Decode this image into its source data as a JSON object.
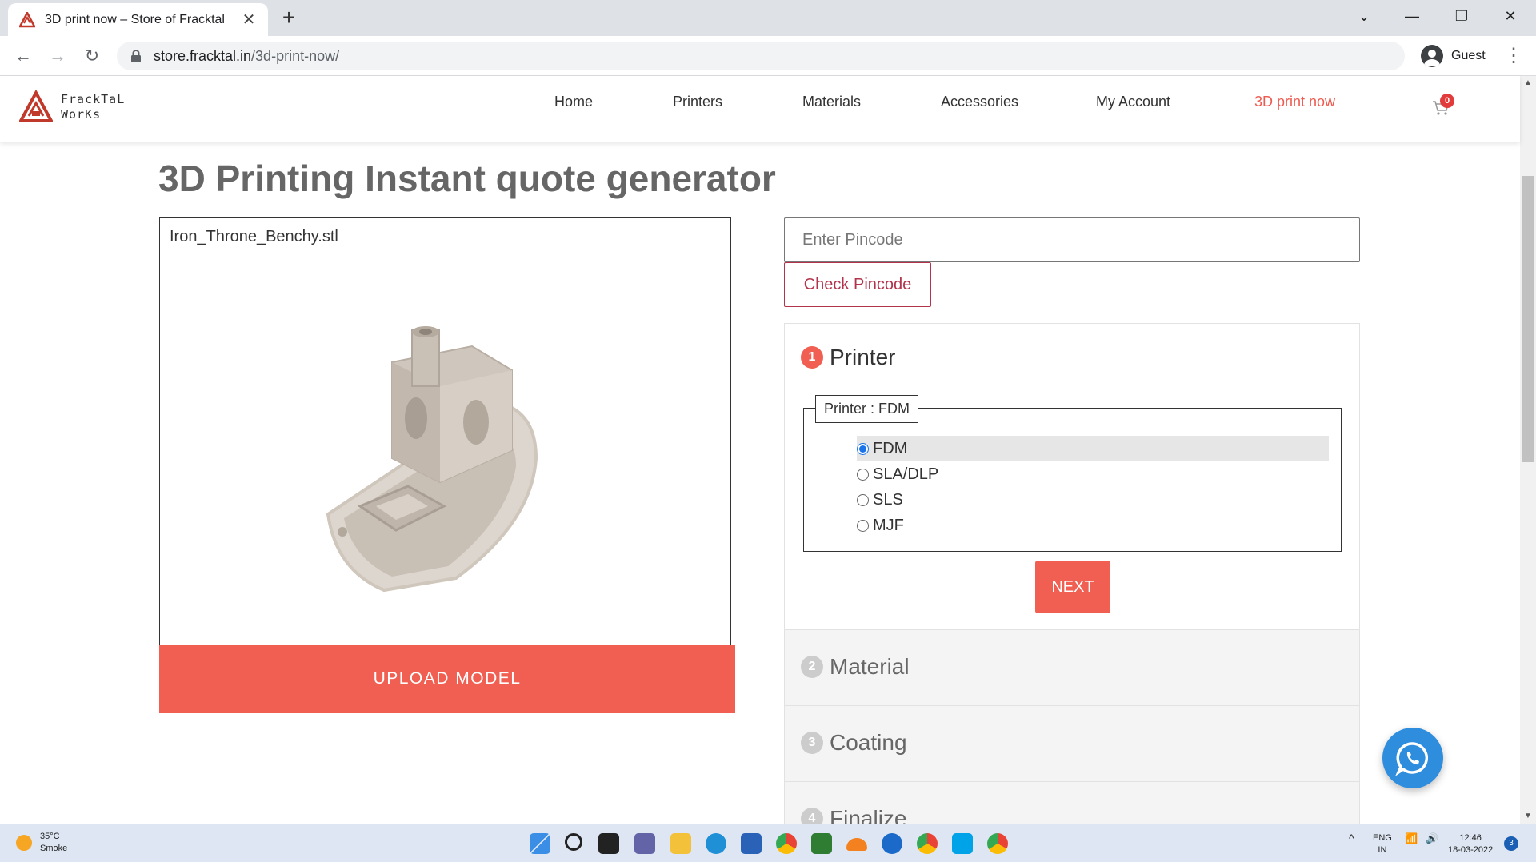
{
  "browser": {
    "tab_title": "3D print now – Store of Fracktal",
    "url_host": "store.fracktal.in",
    "url_path": "/3d-print-now/",
    "profile_label": "Guest"
  },
  "site": {
    "logo_text_line1": "FrackTaL",
    "logo_text_line2": "WorKs",
    "nav": [
      "Home",
      "Printers",
      "Materials",
      "Accessories",
      "My Account",
      "3D print now"
    ],
    "cart_count": "0"
  },
  "page": {
    "title": "3D Printing Instant quote generator",
    "filename": "Iron_Throne_Benchy.stl",
    "upload_label": "UPLOAD MODEL",
    "pincode_placeholder": "Enter Pincode",
    "check_label": "Check Pincode"
  },
  "steps": [
    {
      "num": "1",
      "title": "Printer"
    },
    {
      "num": "2",
      "title": "Material"
    },
    {
      "num": "3",
      "title": "Coating"
    },
    {
      "num": "4",
      "title": "Finalize"
    }
  ],
  "printer_group": {
    "legend": "Printer : FDM",
    "options": [
      "FDM",
      "SLA/DLP",
      "SLS",
      "MJF"
    ],
    "selected": "FDM",
    "next_label": "NEXT"
  },
  "taskbar": {
    "temperature": "35°C",
    "condition": "Smoke",
    "lang1": "ENG",
    "lang2": "IN",
    "time": "12:46",
    "date": "18-03-2022",
    "notifications": "3"
  },
  "colors": {
    "accent": "#f05f51",
    "active_nav": "#ee5a4f",
    "check_border": "#b2344c"
  }
}
